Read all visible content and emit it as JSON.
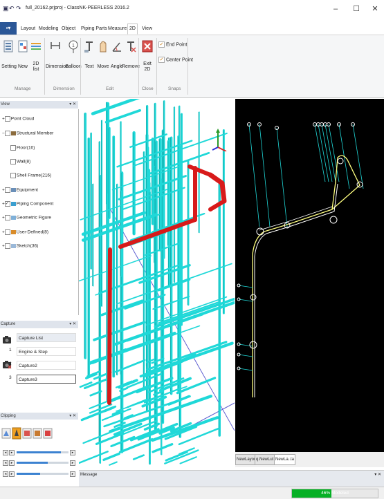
{
  "window": {
    "title": "full_20162.prjproj - ClassNK-PEERLESS 2016.2",
    "controls": [
      "minimize-icon",
      "restore-icon",
      "close-icon"
    ]
  },
  "ribbon": {
    "file_icon": "file-menu-icon",
    "tabs": [
      "Layout",
      "Modeling",
      "Object",
      "Piping Parts",
      "Measure",
      "2D",
      "View"
    ],
    "active_tab": "2D",
    "groups": {
      "manage": {
        "label": "Manage",
        "buttons": [
          "Setting",
          "New",
          "2D",
          "list"
        ]
      },
      "dimension": {
        "label": "Dimension",
        "buttons": [
          "Dimension",
          "Balloon"
        ]
      },
      "edit": {
        "label": "Edit",
        "buttons": [
          "Text",
          "Move",
          "Angle",
          "Remove"
        ]
      },
      "close": {
        "label": "Close",
        "buttons": [
          "Exit",
          "2D"
        ]
      },
      "snaps": {
        "label": "Snaps",
        "end_point": "End Point",
        "center_point": "Center Point"
      }
    }
  },
  "tree_panel": {
    "title": "View",
    "items": [
      {
        "label": "Point Cloud",
        "checked": false
      },
      {
        "label": "Structural Member",
        "checked": false
      },
      {
        "label": "Floor(10)",
        "checked": false
      },
      {
        "label": "Wall(8)",
        "checked": false
      },
      {
        "label": "Shell Frame(216)",
        "checked": false
      },
      {
        "label": "Equipment",
        "checked": false
      },
      {
        "label": "Piping Component",
        "checked": true
      },
      {
        "label": "Geometric Figure",
        "checked": false
      },
      {
        "label": "User-Defined(8)",
        "checked": false
      },
      {
        "label": "Sketch(36)",
        "checked": false
      }
    ]
  },
  "capture_panel": {
    "title": "Capture",
    "list_header": "Capture List",
    "rows": [
      {
        "num": "1",
        "label": "Engine & Step"
      },
      {
        "num": "2",
        "label": "Capture2"
      },
      {
        "num": "3",
        "label": "Capture3"
      }
    ]
  },
  "clipping_panel": {
    "title": "Clipping",
    "sliders": [
      {
        "min": 0.0,
        "max": 0.85
      },
      {
        "min": 0.0,
        "max": 0.6
      },
      {
        "min": 0.0,
        "max": 0.45
      }
    ]
  },
  "layout_tabs": [
    "NewLayout",
    "q.NewLut",
    "NewLa..ta"
  ],
  "active_layout_tab": "NewLa..ta",
  "message_bar": {
    "title": "Message"
  },
  "status": {
    "progress_percent": 46,
    "progress_text": "46%  Modeled"
  },
  "colors": {
    "accent": "#2b5797",
    "pipe_cyan": "#1fd8d8",
    "pipe_red": "#d81a1a",
    "progress_green": "#06b025"
  }
}
